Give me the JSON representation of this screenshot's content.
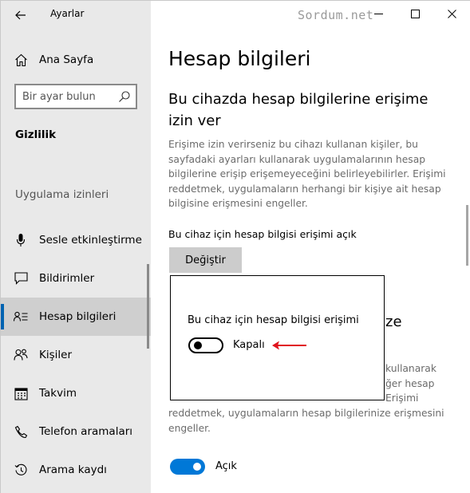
{
  "window": {
    "app_title": "Ayarlar",
    "watermark": "Sordum.net"
  },
  "sidebar": {
    "home_label": "Ana Sayfa",
    "search_placeholder": "Bir ayar bulun",
    "section_heading": "Gizlilik",
    "group_label": "Uygulama izinleri",
    "items": [
      {
        "label": "Sesle etkinleştirme",
        "icon": "microphone-icon"
      },
      {
        "label": "Bildirimler",
        "icon": "notification-icon"
      },
      {
        "label": "Hesap bilgileri",
        "icon": "account-info-icon",
        "selected": true
      },
      {
        "label": "Kişiler",
        "icon": "contacts-icon"
      },
      {
        "label": "Takvim",
        "icon": "calendar-icon"
      },
      {
        "label": "Telefon aramaları",
        "icon": "phone-icon"
      },
      {
        "label": "Arama kaydı",
        "icon": "call-history-icon"
      }
    ]
  },
  "main": {
    "title": "Hesap bilgileri",
    "sub_heading": "Bu cihazda hesap bilgilerine erişime izin ver",
    "description": "Erişime izin verirseniz bu cihazı kullanan kişiler, bu sayfadaki ayarları kullanarak uygulamalarının hesap bilgilerine erişip erişemeyeceğini belirleyebilirler. Erişimi reddetmek, uygulamaların herhangi bir kişiye ait hesap bilgisine erişmesini engeller.",
    "status_line": "Bu cihaz için hesap bilgisi erişimi açık",
    "change_button": "Değiştir",
    "partial_heading": "ze",
    "partial_desc_lines": [
      "kullanarak",
      "ğer hesap",
      "Erişimi"
    ],
    "lower_desc": "reddetmek, uygulamaların hesap bilgilerinize erişmesini engeller.",
    "toggle_on_label": "Açık",
    "toggle_on_state": true
  },
  "dialog": {
    "title": "Bu cihaz için hesap bilgisi erişimi",
    "toggle_label": "Kapalı",
    "toggle_state": false
  },
  "colors": {
    "accent": "#0078d7",
    "selection_bar": "#0063b1",
    "arrow": "#e0141e",
    "sidebar_bg": "#e9e9e9"
  }
}
